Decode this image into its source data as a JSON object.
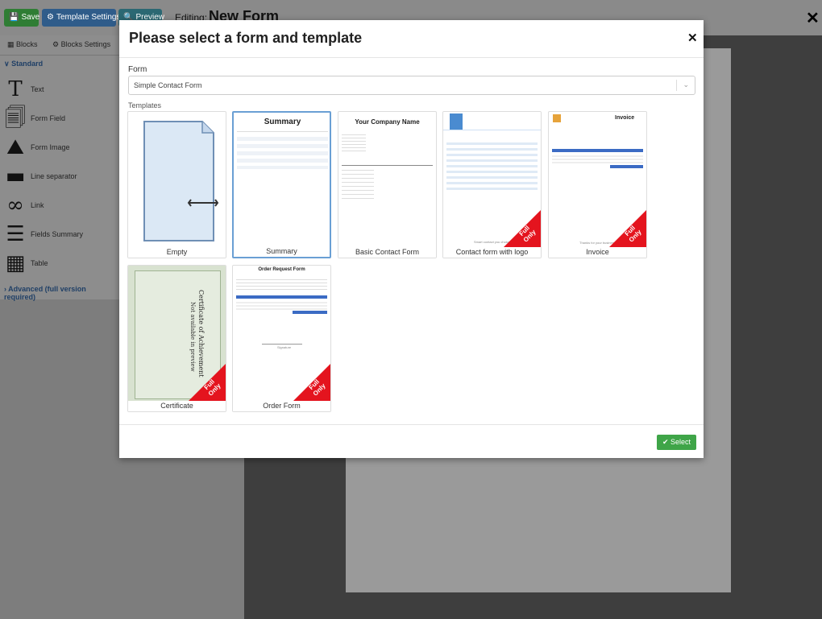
{
  "toolbar": {
    "save_label": "Save",
    "template_settings_label": "Template Settings",
    "preview_label": "Preview",
    "editing_prefix": "Editing:",
    "editing_title": "New Form"
  },
  "sidebar": {
    "tabs": [
      "Blocks",
      "Blocks Settings"
    ],
    "standard_group": "Standard",
    "items": [
      {
        "label": "Text",
        "icon": "text-icon"
      },
      {
        "label": "Form Field",
        "icon": "form-field-icon"
      },
      {
        "label": "Form Image",
        "icon": "image-icon"
      },
      {
        "label": "Line separator",
        "icon": "line-separator-icon"
      },
      {
        "label": "Link",
        "icon": "link-icon"
      },
      {
        "label": "Fields Summary",
        "icon": "list-icon"
      },
      {
        "label": "Table",
        "icon": "table-icon"
      }
    ],
    "advanced_group": "Advanced (full version required)"
  },
  "modal": {
    "title": "Please select a form and template",
    "form_label": "Form",
    "form_value": "Simple Contact Form",
    "templates_label": "Templates",
    "select_label": "Select",
    "templates": [
      {
        "caption": "Empty",
        "full_only": false,
        "selected": false
      },
      {
        "caption": "Summary",
        "full_only": false,
        "selected": true
      },
      {
        "caption": "Basic Contact Form",
        "full_only": false,
        "selected": false
      },
      {
        "caption": "Contact form with logo",
        "full_only": true,
        "selected": false
      },
      {
        "caption": "Invoice",
        "full_only": true,
        "selected": false
      },
      {
        "caption": "Certificate",
        "full_only": true,
        "selected": false
      },
      {
        "caption": "Order Form",
        "full_only": true,
        "selected": false
      }
    ],
    "ribbon_text": "Full Only",
    "thumb_text": {
      "summary_heading": "Summary",
      "company_heading": "Your Company Name",
      "invoice_heading": "Invoice",
      "invoice_footer": "Thanks for your business",
      "logo_footer": "Smart contact you choice",
      "order_heading": "Order Request Form",
      "cert_heading": "Certificate of Achievement",
      "cert_sub": "Not available in preview",
      "cert_sign": "Signature"
    }
  }
}
